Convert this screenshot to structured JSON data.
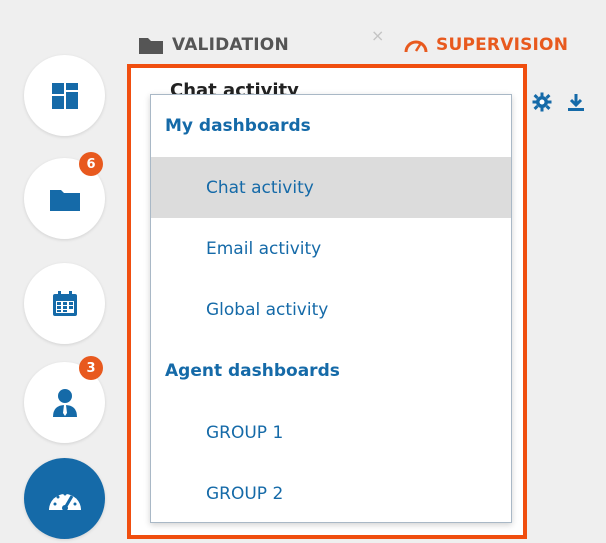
{
  "tabs": [
    {
      "label": "VALIDATION",
      "icon": "folder-icon",
      "color": "#555555",
      "active": false
    },
    {
      "label": "SUPERVISION",
      "icon": "gauge-icon",
      "color": "#e8591e",
      "active": true
    }
  ],
  "tab_close_glyph": "×",
  "sidebar": {
    "items": [
      {
        "icon": "dashboard-grid-icon",
        "badge": ""
      },
      {
        "icon": "folder-icon",
        "badge": "6"
      },
      {
        "icon": "calendar-icon",
        "badge": ""
      },
      {
        "icon": "agent-user-icon",
        "badge": "3"
      },
      {
        "icon": "gauge-icon",
        "badge": "",
        "active": true
      }
    ]
  },
  "header": {
    "title": "Chat activity"
  },
  "toolbar": {
    "settings_icon": "gear-icon",
    "export_icon": "download-icon"
  },
  "dropdown": {
    "sections": [
      {
        "header": "My dashboards",
        "items": [
          {
            "label": "Chat activity",
            "selected": true
          },
          {
            "label": "Email activity",
            "selected": false
          },
          {
            "label": "Global activity",
            "selected": false
          }
        ]
      },
      {
        "header": "Agent dashboards",
        "items": [
          {
            "label": "GROUP 1",
            "selected": false
          },
          {
            "label": "GROUP 2",
            "selected": false
          }
        ]
      }
    ]
  },
  "colors": {
    "accent": "#156aa8",
    "highlight_border": "#f04e0f",
    "badge": "#e8591e",
    "selected_item_bg": "#dcdcdc"
  }
}
